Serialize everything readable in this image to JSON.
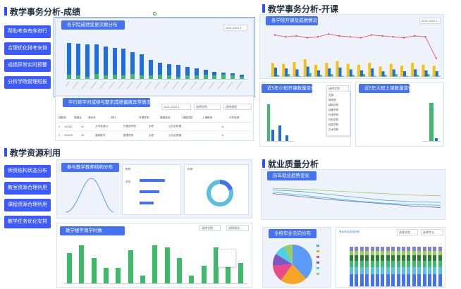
{
  "quadrants": {
    "q1": {
      "title": "教学事务分析-成绩"
    },
    "q2": {
      "title": "教学事务分析-开课"
    },
    "q3": {
      "title": "教学资源利用"
    },
    "q4": {
      "title": "就业质量分析"
    }
  },
  "side_buttons_q1": [
    "帮助考务有序进行",
    "合理优化排考安排",
    "成绩异常实时预警",
    "分析学院管理短板"
  ],
  "side_buttons_q3": [
    "师资结构状态分布",
    "教室资源合理利用",
    "课程资源合理利用",
    "教学任务优化安排"
  ],
  "q1": {
    "banner1": "各学院成绩变更次数分布",
    "banner2": "平行班平时成绩与期末成绩偏离异常情况",
    "select1": "2021-2022-1",
    "select_a": "2021-2022-1",
    "select_b": "选择学院",
    "select_c": "选择课程",
    "table_headers": [
      "课程号",
      "课程名",
      "课序号",
      "学时",
      "开课学院",
      "课程类别",
      "课程性质",
      "上课教师",
      "平时成绩"
    ],
    "table_rows": [
      [
        "1",
        "101357",
        "41",
        "大学英语(2)",
        "外国语学院",
        "必修",
        "公共必修课",
        "",
        "A"
      ],
      [
        "2",
        "101125",
        "18",
        "高等数学",
        "数理学院",
        "必修",
        "公共必修课",
        "",
        "A"
      ]
    ]
  },
  "q2": {
    "banner1": "各学院开课及成绩情况",
    "banner2": "近5年小班开课数量变化",
    "banner3": "近5年大班上课数量变化",
    "select1": "2021-2022-1",
    "select2": "选择学院",
    "dropdown_items": [
      "全部",
      "理学院",
      "建筑学院",
      "经管学院",
      "外语学院",
      "材料学院",
      "信息学院",
      "艺术学院"
    ]
  },
  "q3": {
    "banner1": "参与教学教师结构分布",
    "banner2": "教学楼宇周学时数",
    "small_labels": [
      "职称",
      "学历",
      "年龄",
      "学缘"
    ],
    "select1": "选择学院",
    "select2": "选择周次"
  },
  "q4": {
    "banner1": "历年就业趋势变化",
    "banner2": "全校毕业去向分布",
    "banner3": "专业毕业去向分布",
    "select1": "选择学院",
    "select2": "选择专业"
  },
  "chart_data": [
    {
      "type": "bar",
      "title": "各学院成绩变更次数分布",
      "series": [
        {
          "values": [
            88,
            86,
            85,
            84,
            80,
            76,
            74,
            66,
            60,
            46,
            40,
            36,
            34,
            30,
            26,
            22,
            18,
            16,
            14,
            10
          ]
        },
        {
          "values": [
            10,
            8,
            6,
            12,
            9,
            10,
            8,
            12,
            9,
            8,
            10,
            8,
            6,
            9,
            8,
            10,
            8,
            10,
            8,
            6
          ]
        }
      ]
    },
    {
      "type": "bar",
      "title": "各学院开课及成绩情况",
      "series": [
        {
          "values": [
            30,
            28,
            32,
            38,
            26,
            30,
            34,
            28,
            26,
            30,
            22,
            28,
            24,
            30,
            26,
            24
          ]
        },
        {
          "values": [
            20,
            18,
            16,
            22,
            14,
            18,
            20,
            16,
            14,
            18,
            12,
            16,
            12,
            16,
            14,
            12
          ]
        },
        {
          "values": [
            4,
            6,
            2,
            8,
            4,
            6,
            2,
            4,
            6,
            2,
            4,
            6,
            2,
            4,
            6,
            2
          ]
        },
        {
          "values": [
            90,
            86,
            88,
            84,
            86,
            92,
            88,
            86,
            84,
            90,
            88,
            86,
            84,
            88,
            86,
            40
          ]
        }
      ]
    },
    {
      "type": "bar",
      "title": "教学楼宇周学时数",
      "values": [
        24,
        30,
        20,
        12,
        12,
        26,
        6,
        30,
        28,
        20,
        6,
        14,
        28,
        26,
        16
      ]
    },
    {
      "type": "line",
      "title": "历年就业趋势变化",
      "series": [
        {
          "values": [
            80,
            78,
            74,
            70,
            66,
            62,
            60
          ]
        },
        {
          "values": [
            76,
            72,
            64,
            56,
            48,
            44,
            42
          ]
        },
        {
          "values": [
            70,
            62,
            54,
            46,
            40,
            36,
            34
          ]
        },
        {
          "values": [
            66,
            58,
            50,
            44,
            38,
            32,
            28
          ]
        }
      ]
    },
    {
      "type": "pie",
      "title": "全校毕业去向分布",
      "values": [
        38,
        22,
        14,
        10,
        9,
        7
      ]
    }
  ],
  "colors": {
    "accent": "#2f54eb",
    "blue": "#1e6fe0",
    "green": "#3dbb6b",
    "yellow": "#f5c211",
    "red": "#e84a5f",
    "banner": "#4472f2"
  }
}
